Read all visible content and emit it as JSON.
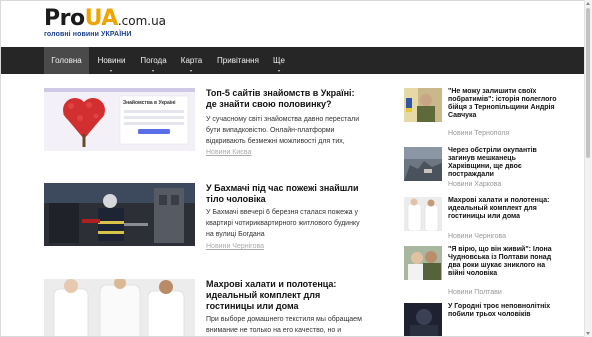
{
  "logo": {
    "brand_pro": "Pro",
    "brand_ua": "UA",
    "brand_domain": ".com.ua",
    "tagline": "головні новини УКРАЇНИ"
  },
  "nav": {
    "items": [
      {
        "label": "Головна"
      },
      {
        "label": "Новини"
      },
      {
        "label": "Погода"
      },
      {
        "label": "Карта"
      },
      {
        "label": "Привітання"
      },
      {
        "label": "Ще"
      }
    ]
  },
  "articles": [
    {
      "title": "Топ-5 сайтів знайомств в Україні: де знайти свою половинку?",
      "excerpt": "У сучасному світі знайомства давно перестали бути випадковістю. Онлайн-платформи відкривають безмежні можливості для тих,",
      "meta": "Новини Києва",
      "thumb_text": "Знайомства в Україні"
    },
    {
      "title": "У Бахмачі під час пожежі знайшли тіло чоловіка",
      "excerpt": "У Бахмачі ввечері 6 березня сталася пожежа у квартирі чотириквартирного житлового будинку на вулиці Богдана",
      "meta": "Новини Чернігова"
    },
    {
      "title": "Махрові халати и полотенца: идеальный комплект для гостиницы или дома",
      "excerpt": "При выборе домашнего текстиля мы обращаем внимание не только на его качество, но и"
    }
  ],
  "sidebar": [
    {
      "title": "\"Не можу залишити своїх побратимів\": історія полеглого бійця з Тернопільщини Андрія Савчука",
      "meta": "Новини Тернополя"
    },
    {
      "title": "Через обстріли окупантів загинув мешканець Харківщини, ще двоє постраждали",
      "meta": "Новини Харкова"
    },
    {
      "title": "Махрові халати и полотенца: идеальный комплект для гостиницы или дома",
      "meta": "Новини Чернігова"
    },
    {
      "title": "\"Я вірю, що він живий\": Ілона Чудновська із Полтави понад два роки шукає зниклого на війні чоловіка",
      "meta": "Новини Полтави"
    },
    {
      "title": "У Городні троє неповнолітніх побили трьох чоловіків"
    }
  ],
  "colors": {
    "nav_bg": "#262626",
    "nav_active": "#4a4a4a",
    "brand_accent": "#f0a400",
    "tagline": "#1b3f8a"
  }
}
